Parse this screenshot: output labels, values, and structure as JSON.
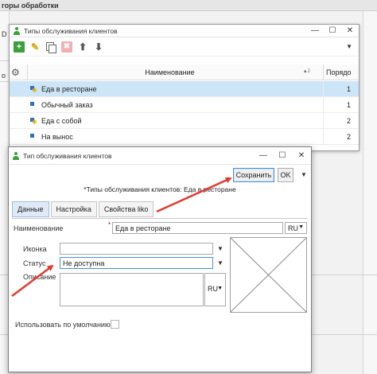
{
  "background": {
    "title": "горы обработки",
    "left_glyphs": [
      "D",
      "o"
    ]
  },
  "list_window": {
    "title": "Типы обслуживания клиентов",
    "toolbar": {
      "add": "+",
      "edit": "✎",
      "delete": "✖",
      "up": "⬆",
      "down": "⬇",
      "more": "▼"
    },
    "columns": {
      "name": "Наименование",
      "name_sort": "▲2",
      "order": "Порядо"
    },
    "rows": [
      {
        "name": "Еда в ресторане",
        "order": "1",
        "icon": "food-star-icon",
        "selected": true
      },
      {
        "name": "Обычный заказ",
        "order": "1",
        "icon": "square-icon",
        "selected": false
      },
      {
        "name": "Еда с собой",
        "order": "2",
        "icon": "food-star-icon",
        "selected": false
      },
      {
        "name": "На вынос",
        "order": "2",
        "icon": "square-icon",
        "selected": false
      }
    ]
  },
  "dialog": {
    "title": "Тип обслуживания клиентов",
    "save_label": "Сохранить",
    "ok_label": "OK",
    "more": "▼",
    "breadcrumb": "*Типы обслуживания клиентов:  Еда в ресторане",
    "tabs": [
      "Данные",
      "Настройка",
      "Свойства liko"
    ],
    "active_tab": 0,
    "name_label": "Наименование",
    "name_required_mark": "*",
    "name_value": "Еда в ресторане",
    "lang_value": "RU",
    "icon_label": "Иконка",
    "icon_value": "",
    "status_label": "Статус",
    "status_value": "Не доступна",
    "description_label": "Описание",
    "description_value": "",
    "desc_lang": "RU",
    "default_label": "Использовать по умолчанию",
    "default_checked": false
  },
  "colors": {
    "selection": "#cde6f7",
    "arrow": "#e23b2e",
    "add_green": "#3aa03a"
  }
}
